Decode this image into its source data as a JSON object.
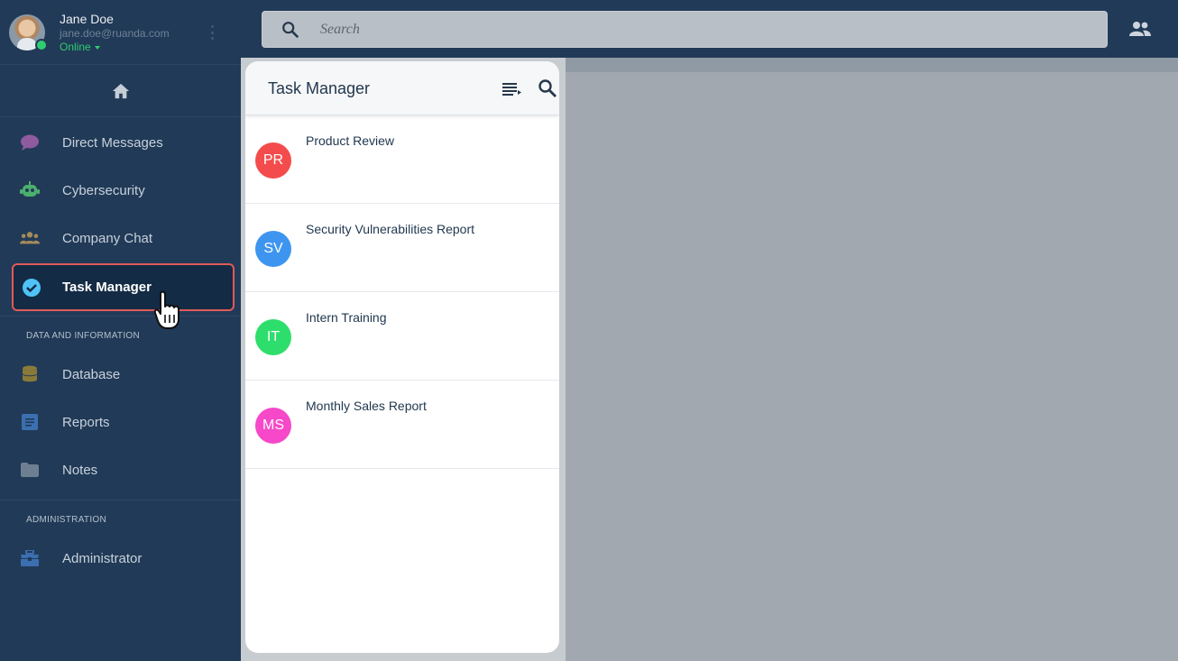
{
  "user": {
    "name": "Jane Doe",
    "email": "jane.doe@ruanda.com",
    "status": "Online"
  },
  "search": {
    "placeholder": "Search"
  },
  "sidebar": {
    "items": [
      {
        "label": "Direct Messages",
        "icon": "chat-bubble-icon",
        "color": "#8e5b9f"
      },
      {
        "label": "Cybersecurity",
        "icon": "robot-icon",
        "color": "#4caf6e"
      },
      {
        "label": "Company Chat",
        "icon": "group-icon",
        "color": "#a48a5c"
      },
      {
        "label": "Task Manager",
        "icon": "check-circle-icon",
        "color": "#4fc3f7",
        "active": true
      }
    ],
    "section_data": "DATA AND INFORMATION",
    "data_items": [
      {
        "label": "Database",
        "icon": "database-icon",
        "color": "#8a7a3a"
      },
      {
        "label": "Reports",
        "icon": "document-icon",
        "color": "#3b6fb0"
      },
      {
        "label": "Notes",
        "icon": "folder-icon",
        "color": "#6f7f92"
      }
    ],
    "section_admin": "ADMINISTRATION",
    "admin_items": [
      {
        "label": "Administrator",
        "icon": "toolbox-icon",
        "color": "#3b6fb0"
      }
    ]
  },
  "panel": {
    "title": "Task Manager",
    "tasks": [
      {
        "initials": "PR",
        "title": "Product Review",
        "color": "#f44c4c"
      },
      {
        "initials": "SV",
        "title": "Security Vulnerabilities Report",
        "color": "#3d95f0"
      },
      {
        "initials": "IT",
        "title": "Intern Training",
        "color": "#2ede6c"
      },
      {
        "initials": "MS",
        "title": "Monthly Sales Report",
        "color": "#f648c8"
      }
    ]
  }
}
